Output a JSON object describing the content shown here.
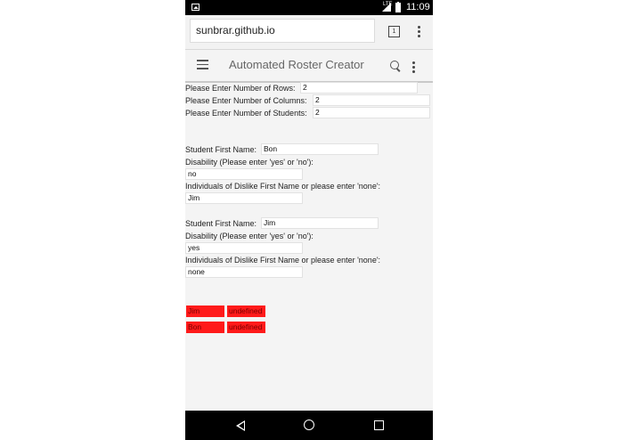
{
  "status_bar": {
    "time": "11:09",
    "network": "LTE"
  },
  "browser": {
    "url": "sunbrar.github.io",
    "tab_count": "1"
  },
  "app_bar": {
    "title": "Automated Roster Creator"
  },
  "setup": {
    "rows_label": "Please Enter Number of Rows:",
    "rows_value": "2",
    "columns_label": "Please Enter Number of Columns:",
    "columns_value": "2",
    "students_label": "Please Enter Number of Students:",
    "students_value": "2"
  },
  "students": [
    {
      "first_name_label": "Student First Name:",
      "first_name": "Bon",
      "disability_label": "Disability (Please enter 'yes' or 'no'):",
      "disability": "no",
      "dislike_label": "Individuals of Dislike First Name or please enter 'none':",
      "dislike": "Jim"
    },
    {
      "first_name_label": "Student First Name:",
      "first_name": "Jim",
      "disability_label": "Disability (Please enter 'yes' or 'no'):",
      "disability": "yes",
      "dislike_label": "Individuals of Dislike First Name or please enter 'none':",
      "dislike": "none"
    }
  ],
  "roster": [
    [
      "Jim",
      "undefined"
    ],
    [
      "Bon",
      "undefined"
    ]
  ],
  "colors": {
    "cell_fill": "#ff1a1a",
    "page_bg": "#f4f4f4"
  }
}
